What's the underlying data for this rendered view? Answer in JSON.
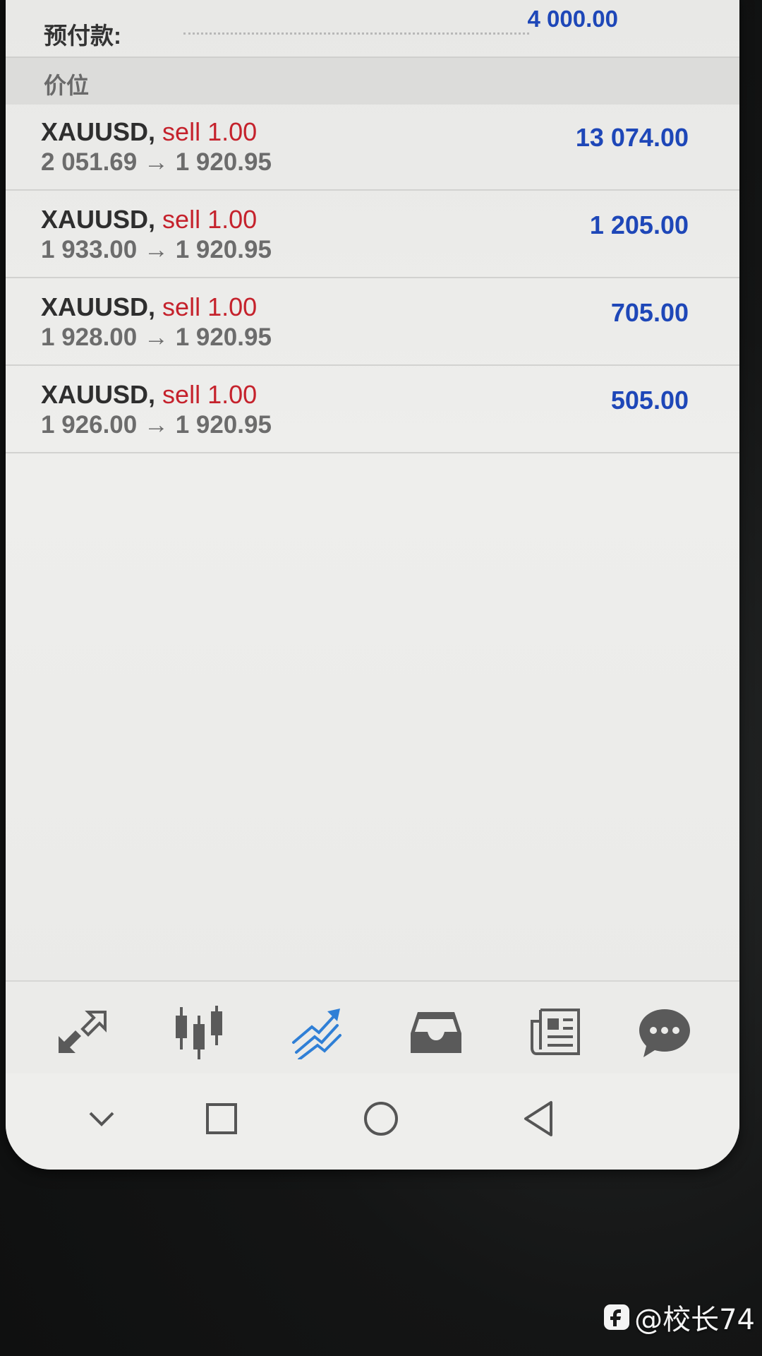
{
  "account": {
    "prepaid_label": "预付款:",
    "prepaid_value": "4 000.00"
  },
  "section": {
    "title": "价位"
  },
  "positions": [
    {
      "symbol": "XAUUSD,",
      "action": "sell 1.00",
      "price_line": "2 051.69 → 1 920.95",
      "profit": "13 074.00"
    },
    {
      "symbol": "XAUUSD,",
      "action": "sell 1.00",
      "price_line": "1 933.00 → 1 920.95",
      "profit": "1 205.00"
    },
    {
      "symbol": "XAUUSD,",
      "action": "sell 1.00",
      "price_line": "1 928.00 → 1 920.95",
      "profit": "705.00"
    },
    {
      "symbol": "XAUUSD,",
      "action": "sell 1.00",
      "price_line": "1 926.00 → 1 920.95",
      "profit": "505.00"
    }
  ],
  "tabs": [
    {
      "name": "quotes-tab",
      "icon": "quotes-arrows-icon",
      "active": false
    },
    {
      "name": "chart-tab",
      "icon": "candlestick-icon",
      "active": false
    },
    {
      "name": "trade-tab",
      "icon": "trade-trend-icon",
      "active": true
    },
    {
      "name": "history-tab",
      "icon": "inbox-icon",
      "active": false
    },
    {
      "name": "news-tab",
      "icon": "news-icon",
      "active": false
    },
    {
      "name": "messages-tab",
      "icon": "chat-bubble-icon",
      "active": false
    }
  ],
  "navigation": [
    "chevron-down-icon",
    "recent-apps-icon",
    "home-icon",
    "back-icon"
  ],
  "watermark": {
    "text": "@校长74"
  },
  "colors": {
    "profit_blue": "#1e47b8",
    "sell_red": "#c5222c",
    "active_tab_blue": "#2f7fd6",
    "icon_gray": "#5a5a5a"
  }
}
